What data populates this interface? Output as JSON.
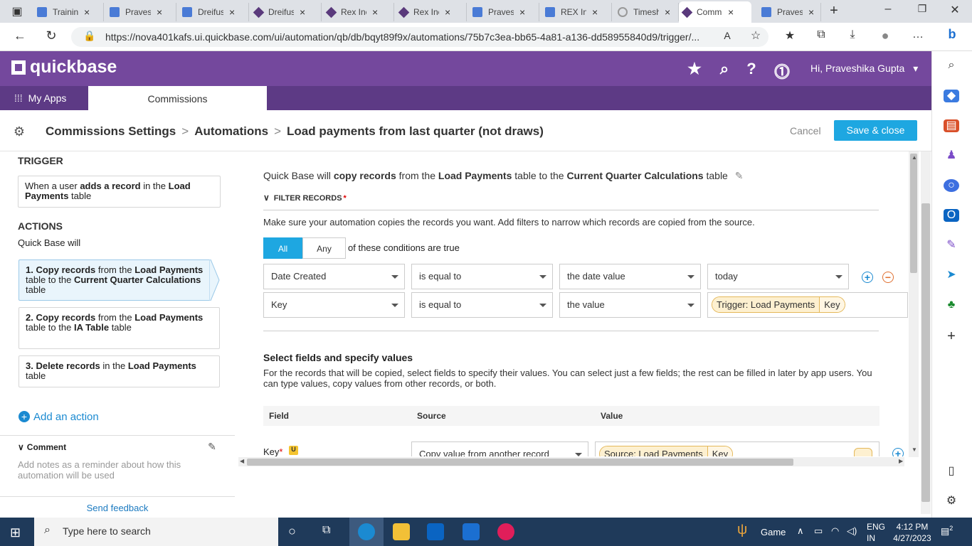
{
  "browser": {
    "tabs": [
      {
        "title": "Training",
        "kind": "doc"
      },
      {
        "title": "Praveshika",
        "kind": "doc"
      },
      {
        "title": "Dreifuss",
        "kind": "doc"
      },
      {
        "title": "Dreifuss",
        "kind": "qb"
      },
      {
        "title": "Rex Inc",
        "kind": "qb"
      },
      {
        "title": "Rex Inc",
        "kind": "qb"
      },
      {
        "title": "Praveshika",
        "kind": "doc"
      },
      {
        "title": "REX Inc",
        "kind": "doc"
      },
      {
        "title": "Timesheet",
        "kind": "ts"
      },
      {
        "title": "Commissions",
        "kind": "qb",
        "active": true
      },
      {
        "title": "Praveshika",
        "kind": "doc"
      }
    ],
    "url": "https://nova401kafs.ui.quickbase.com/ui/automation/qb/db/bqyt89f9x/automations/75b7c3ea-bb65-4a81-a136-dd58955840d9/trigger/..."
  },
  "qb": {
    "logo": "quickbase",
    "my_apps": "My Apps",
    "app_tab": "Commissions",
    "greeting": "Hi, Praveshika Gupta"
  },
  "pagebar": {
    "crumb1": "Commissions Settings",
    "crumb2": "Automations",
    "crumb3": "Load payments from last quarter (not draws)",
    "sep": ">",
    "cancel": "Cancel",
    "save": "Save & close"
  },
  "left": {
    "trigger_title": "TRIGGER",
    "trigger_card": {
      "a": "When a user ",
      "b": "adds a record",
      "c": " in the ",
      "d": "Load Payments",
      "e": " table"
    },
    "actions_title": "ACTIONS",
    "actions_sub": "Quick Base will",
    "action1": {
      "a": "1. Copy records",
      "b": " from the ",
      "c": "Load Payments",
      "d": " table to the ",
      "e": "Current Quarter Calculations",
      "f": " table"
    },
    "action2": {
      "a": "2. Copy records",
      "b": " from the ",
      "c": "Load Payments",
      "d": " table to the ",
      "e": "IA Table",
      "f": " table"
    },
    "action3": {
      "a": "3. Delete records",
      "b": " in the ",
      "c": "Load Payments",
      "d": " table"
    },
    "add_action": "Add an action",
    "comment": "Comment",
    "comment_hint": "Add notes as a reminder about how this automation will be used",
    "feedback": "Send feedback"
  },
  "main": {
    "summary": {
      "a": "Quick Base will ",
      "b": "copy records",
      "c": " from the ",
      "d": "Load Payments",
      "e": " table to the ",
      "f": "Current Quarter Calculations",
      "g": " table"
    },
    "filter_title": "FILTER RECORDS",
    "filter_req": "*",
    "filter_desc": "Make sure your automation copies the records you want. Add filters to narrow which records are copied from the source.",
    "seg_all": "All",
    "seg_any": "Any",
    "cond_text": "of these conditions are true",
    "row1": {
      "field": "Date Created",
      "op": "is equal to",
      "type": "the date value",
      "value": "today"
    },
    "row2": {
      "field": "Key",
      "op": "is equal to",
      "type": "the value",
      "pill1": "Trigger: Load Payments",
      "pill2": "Key"
    },
    "sf_title": "Select fields and specify values",
    "sf_desc": "For the records that will be copied, select fields to specify their values. You can select just a few fields; the rest can be filled in later by app users. You can type values, copy values from other records, or both.",
    "col_field": "Field",
    "col_source": "Source",
    "col_value": "Value",
    "key_field": "Key",
    "key_req": "*",
    "key_badge": "U",
    "key_source": "Copy value from another record",
    "key_pill1": "Source: Load Payments",
    "key_pill2": "Key"
  },
  "taskbar": {
    "search": "Type here to search",
    "game": "Game",
    "lang1": "ENG",
    "lang2": "IN",
    "time": "4:12 PM",
    "date": "4/27/2023",
    "notif": "2"
  }
}
